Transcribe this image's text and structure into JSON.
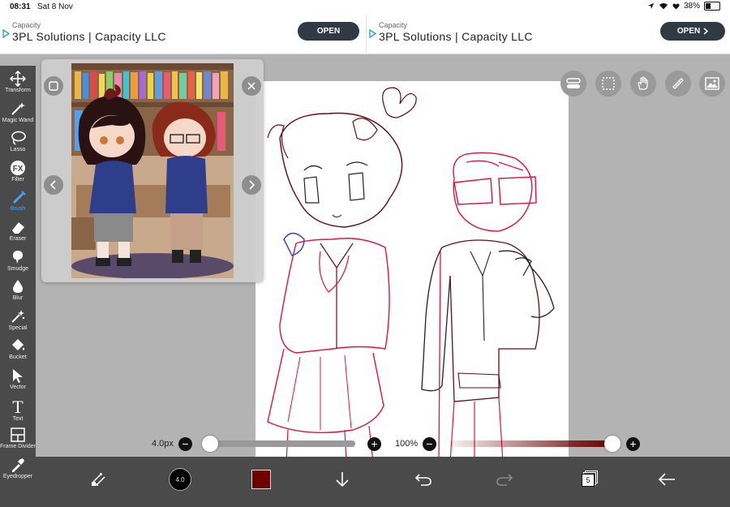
{
  "status": {
    "time": "08:31",
    "date": "Sat 8 Nov",
    "battery": "38%",
    "battery_level": 0.38
  },
  "ads": [
    {
      "brand": "Capacity",
      "title": "3PL Solutions | Capacity LLC",
      "button": "OPEN"
    },
    {
      "brand": "Capacity",
      "title": "3PL Solutions | Capacity LLC",
      "button": "OPEN"
    }
  ],
  "tools": [
    {
      "label": "Transform",
      "icon": "transform-icon"
    },
    {
      "label": "Magic Wand",
      "icon": "magic-wand-icon"
    },
    {
      "label": "Lasso",
      "icon": "lasso-icon"
    },
    {
      "label": "Filter",
      "icon": "fx-icon",
      "glyph": "FX"
    },
    {
      "label": "Brush",
      "icon": "brush-icon",
      "active": true
    },
    {
      "label": "Eraser",
      "icon": "eraser-icon"
    },
    {
      "label": "Smudge",
      "icon": "smudge-icon"
    },
    {
      "label": "Blur",
      "icon": "blur-drop-icon"
    },
    {
      "label": "Special",
      "icon": "special-sparkle-icon"
    },
    {
      "label": "Bucket",
      "icon": "bucket-icon"
    },
    {
      "label": "Vector",
      "icon": "vector-cursor-icon"
    },
    {
      "label": "Text",
      "icon": "text-icon",
      "glyph": "T"
    },
    {
      "label": "Frame Divider",
      "icon": "frame-divider-icon"
    },
    {
      "label": "Eyedropper",
      "icon": "eyedropper-icon"
    }
  ],
  "brush": {
    "size_label": "4.0px",
    "size_value": 4.0,
    "size_fraction": 0.02,
    "opacity_label": "100%",
    "opacity_fraction": 1.0,
    "preview_text": "4.0"
  },
  "color": {
    "primary": "#6e0000",
    "accent": "#4aa3ff"
  },
  "layers": {
    "count": "5"
  },
  "top_icons": [
    "layers-toggle-icon",
    "selection-icon",
    "hand-icon",
    "ruler-icon",
    "image-icon"
  ]
}
